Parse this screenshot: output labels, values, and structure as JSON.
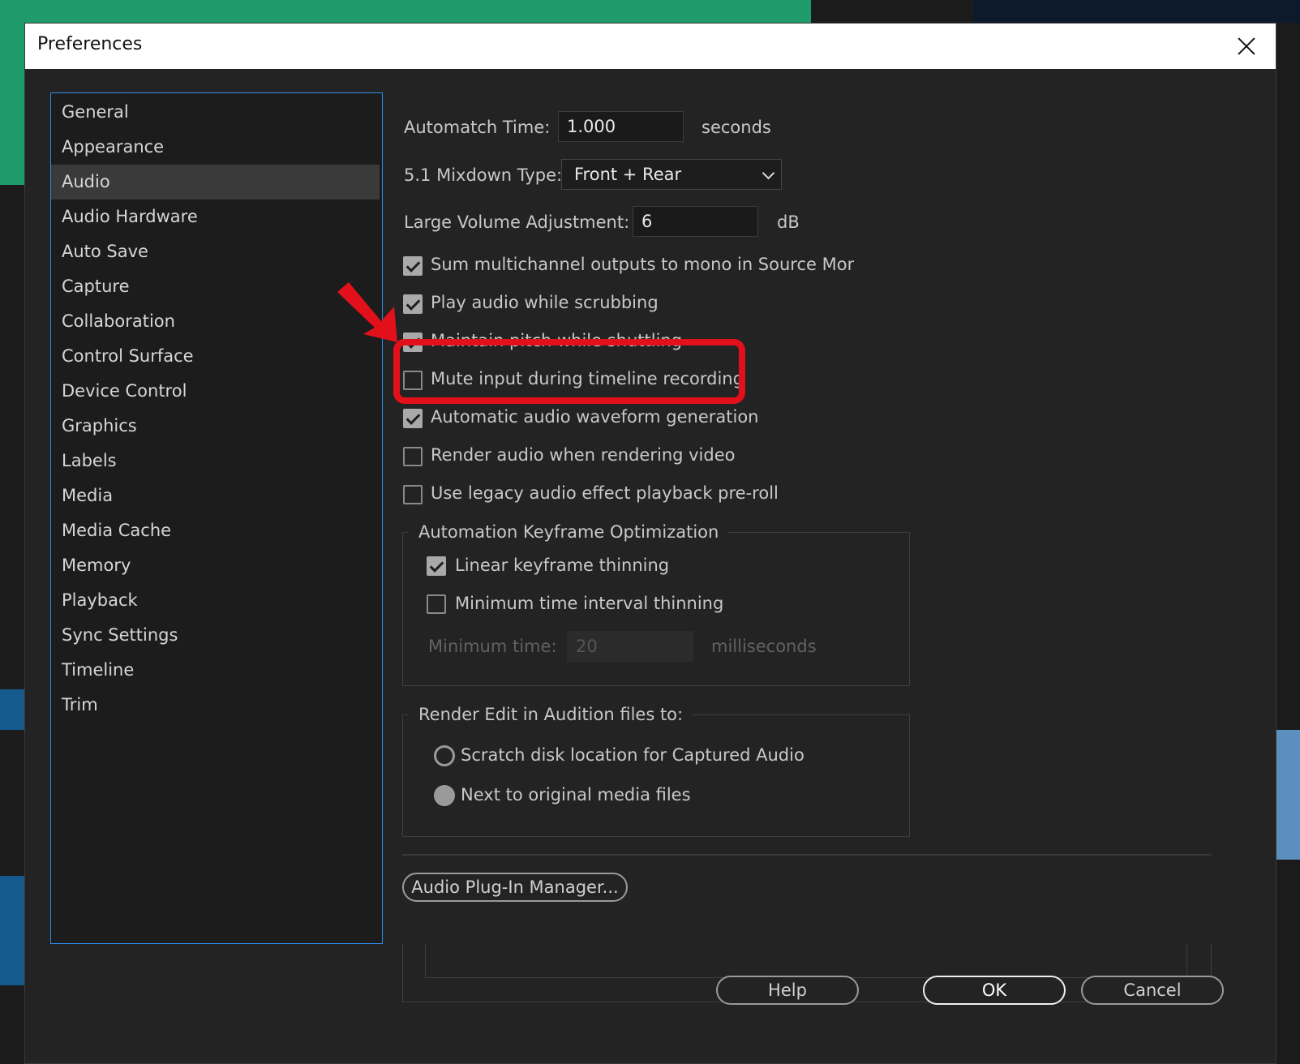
{
  "dialog": {
    "title": "Preferences"
  },
  "sidebar": {
    "selected": "Audio",
    "items": [
      {
        "label": "General"
      },
      {
        "label": "Appearance"
      },
      {
        "label": "Audio"
      },
      {
        "label": "Audio Hardware"
      },
      {
        "label": "Auto Save"
      },
      {
        "label": "Capture"
      },
      {
        "label": "Collaboration"
      },
      {
        "label": "Control Surface"
      },
      {
        "label": "Device Control"
      },
      {
        "label": "Graphics"
      },
      {
        "label": "Labels"
      },
      {
        "label": "Media"
      },
      {
        "label": "Media Cache"
      },
      {
        "label": "Memory"
      },
      {
        "label": "Playback"
      },
      {
        "label": "Sync Settings"
      },
      {
        "label": "Timeline"
      },
      {
        "label": "Trim"
      }
    ]
  },
  "audio": {
    "automatch_label": "Automatch Time:",
    "automatch_value": "1.000",
    "automatch_unit": "seconds",
    "mixdown_label": "5.1 Mixdown Type:",
    "mixdown_value": "Front + Rear",
    "volume_label": "Large Volume Adjustment:",
    "volume_value": "6",
    "volume_unit": "dB",
    "options": [
      {
        "label": "Sum multichannel outputs to mono in Source Monitor",
        "checked": true
      },
      {
        "label": "Play audio while scrubbing",
        "checked": true
      },
      {
        "label": "Maintain pitch while shuttling",
        "checked": true
      },
      {
        "label": "Mute input during timeline recording",
        "checked": false
      },
      {
        "label": "Automatic audio waveform generation",
        "checked": true
      },
      {
        "label": "Render audio when rendering video",
        "checked": false
      },
      {
        "label": "Use legacy audio effect playback pre-roll",
        "checked": false
      }
    ],
    "keyframe_group": {
      "title": "Automation Keyframe Optimization",
      "options": [
        {
          "label": "Linear keyframe thinning",
          "checked": true
        },
        {
          "label": "Minimum time interval thinning",
          "checked": false
        }
      ],
      "min_time_label": "Minimum time:",
      "min_time_value": "20",
      "min_time_unit": "milliseconds"
    },
    "render_group": {
      "title": "Render Edit in Audition files to:",
      "options": [
        {
          "label": "Scratch disk location for Captured Audio",
          "selected": false
        },
        {
          "label": "Next to original media files",
          "selected": true
        }
      ]
    },
    "plugin_manager_label": "Audio Plug-In Manager..."
  },
  "footer": {
    "help_label": "Help",
    "ok_label": "OK",
    "cancel_label": "Cancel"
  },
  "annotation": {
    "color": "#e2101b"
  }
}
